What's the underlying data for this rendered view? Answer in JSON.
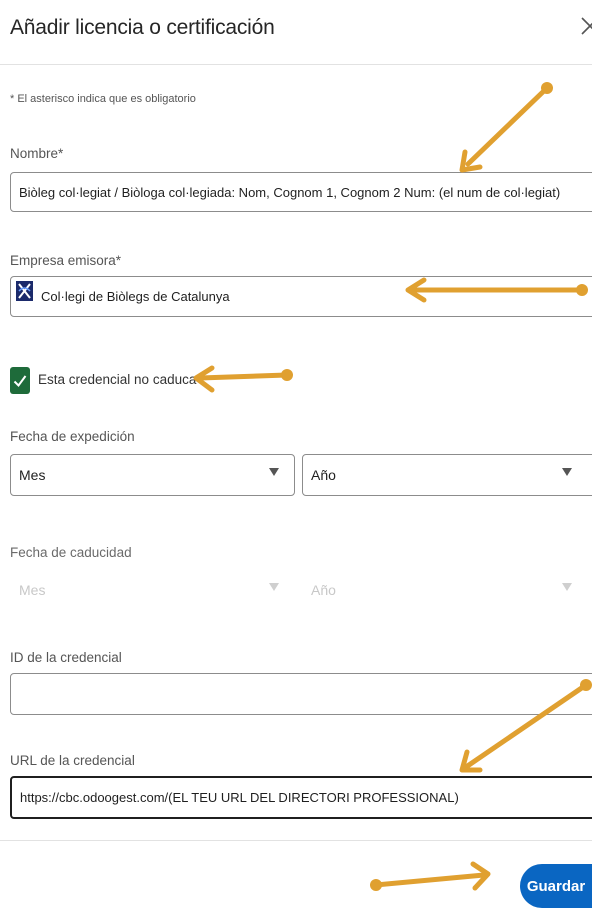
{
  "dialog": {
    "title": "Añadir licencia o certificación",
    "required_note": "* El asterisco indica que es obligatorio"
  },
  "form": {
    "name": {
      "label": "Nombre*",
      "value": "Biòleg col·legiat / Biòloga col·legiada:  Nom, Cognom 1, Cognom 2 Num: (el num de col·legiat)"
    },
    "issuer": {
      "label": "Empresa emisora*",
      "value": "Col·legi de Biòlegs de Catalunya"
    },
    "no_expiry": {
      "label": "Esta credencial no caduca",
      "checked": true
    },
    "issue_date": {
      "label": "Fecha de expedición",
      "month": "Mes",
      "year": "Año"
    },
    "expiry_date": {
      "label": "Fecha de caducidad",
      "month": "Mes",
      "year": "Año",
      "disabled": true
    },
    "credential_id": {
      "label": "ID de la credencial",
      "value": ""
    },
    "credential_url": {
      "label": "URL de la credencial",
      "value": "https://cbc.odoogest.com/(EL TEU URL DEL DIRECTORI PROFESSIONAL)"
    }
  },
  "footer": {
    "save_label": "Guardar"
  },
  "colors": {
    "primary": "#0a66c2",
    "checkbox": "#1e6b3a",
    "annotation_arrow": "#e0a030"
  }
}
